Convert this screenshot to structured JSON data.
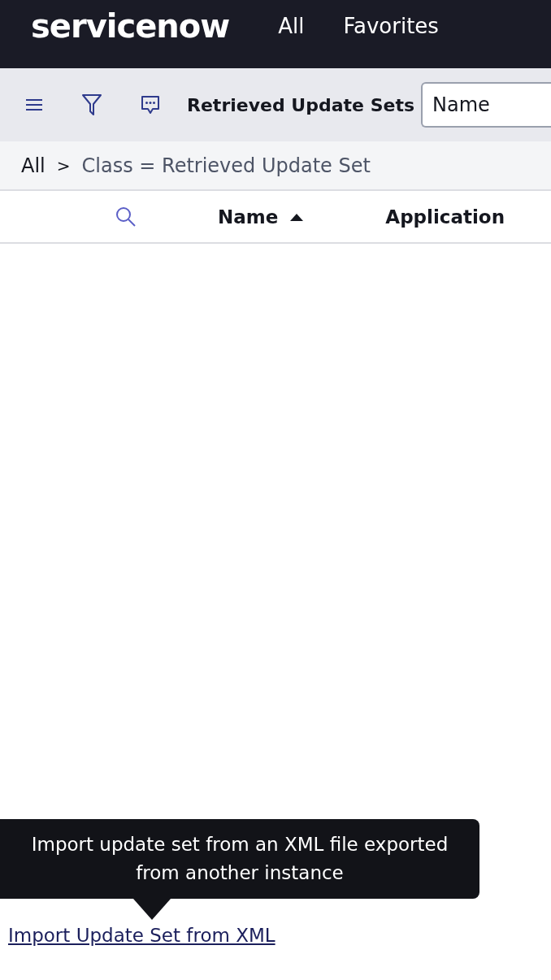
{
  "header": {
    "logo": "servicenow",
    "nav": [
      "All",
      "Favorites"
    ]
  },
  "toolbar": {
    "title": "Retrieved Update Sets",
    "search": {
      "value": "Name"
    }
  },
  "breadcrumb": {
    "root": "All",
    "separator": ">",
    "filter": "Class = Retrieved Update Set"
  },
  "table": {
    "columns": [
      {
        "label": "Name",
        "sorted": true
      },
      {
        "label": "Application",
        "sorted": false
      }
    ]
  },
  "related_links": {
    "links": [
      "Import Update Set from XML"
    ]
  },
  "tooltip": {
    "text": "Import update set from an XML file exported from another instance"
  }
}
